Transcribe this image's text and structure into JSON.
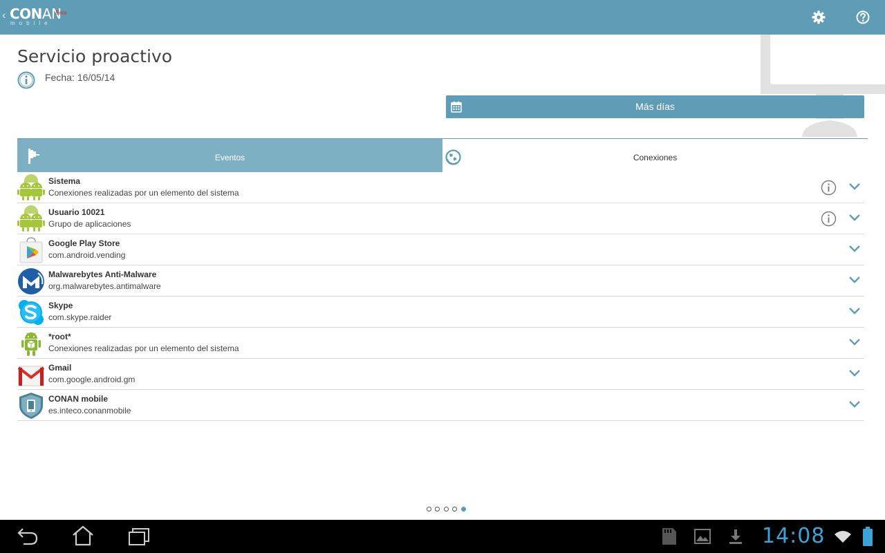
{
  "app": {
    "logo_text_bold": "CON",
    "logo_text_light": "AN",
    "logo_sub": "mobile",
    "logo_badge": "Beta"
  },
  "header": {
    "title": "Servicio proactivo",
    "date_label": "Fecha:",
    "date_value": "16/05/14",
    "more_days_label": "Más días"
  },
  "tabs": [
    {
      "label": "Eventos",
      "selected": false
    },
    {
      "label": "Conexiones",
      "selected": true
    }
  ],
  "apps": [
    {
      "name": "Sistema",
      "detail": "Conexiones realizadas por un elemento del sistema",
      "icon": "android-group-icon",
      "has_info": true
    },
    {
      "name": "Usuario 10021",
      "detail": "Grupo de aplicaciones",
      "icon": "android-group-icon",
      "has_info": true
    },
    {
      "name": "Google Play Store",
      "detail": "com.android.vending",
      "icon": "play-store-icon",
      "has_info": false
    },
    {
      "name": "Malwarebytes Anti-Malware",
      "detail": "org.malwarebytes.antimalware",
      "icon": "malwarebytes-icon",
      "has_info": false
    },
    {
      "name": "Skype",
      "detail": "com.skype.raider",
      "icon": "skype-icon",
      "has_info": false
    },
    {
      "name": "*root*",
      "detail": "Conexiones realizadas por un elemento del sistema",
      "icon": "android-robot-icon",
      "has_info": false
    },
    {
      "name": "Gmail",
      "detail": "com.google.android.gm",
      "icon": "gmail-icon",
      "has_info": false
    },
    {
      "name": "CONAN mobile",
      "detail": "es.inteco.conanmobile",
      "icon": "conan-shield-icon",
      "has_info": false
    }
  ],
  "pager": {
    "count": 5,
    "active_index": 4
  },
  "status_bar": {
    "time": "14:08"
  },
  "colors": {
    "accent": "#5f9cb5",
    "tab_inactive": "#7eb0c4",
    "clock": "#3aa4d8",
    "android_green": "#a4c639"
  }
}
